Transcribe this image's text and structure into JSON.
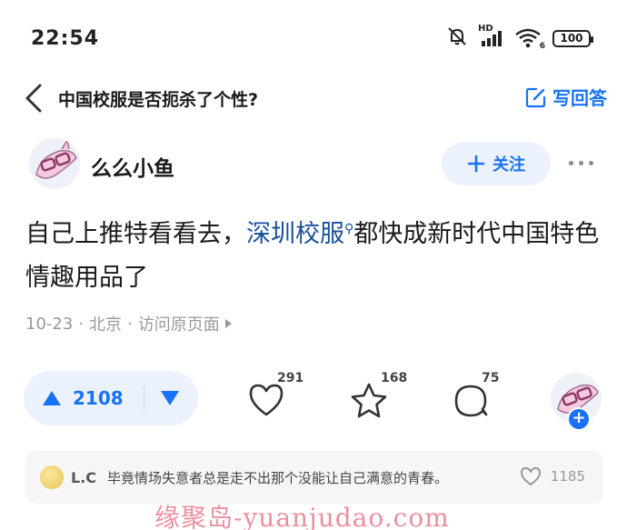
{
  "status_bar": {
    "time": "22:54",
    "network_label": "HD",
    "wifi_label": "6",
    "battery_level": "100",
    "icons": [
      "mute-bell-icon",
      "cellular-signal-icon",
      "wifi-icon",
      "battery-icon"
    ]
  },
  "nav": {
    "title": "中国校服是否扼杀了个性?",
    "write_answer_label": "写回答",
    "icons": [
      "back-arrow-icon",
      "edit-icon"
    ]
  },
  "author": {
    "name": "么么小鱼",
    "follow_label": "关注"
  },
  "answer": {
    "text_before": "自己上推特看看去，",
    "link_text": "深圳校服",
    "text_after": "都快成新时代中国特色情趣用品了"
  },
  "meta": {
    "date": "10-23",
    "location": "北京",
    "visit_label": "访问原页面"
  },
  "actions": {
    "upvotes": "2108",
    "likes": "291",
    "favorites": "168",
    "comments": "75"
  },
  "top_comment": {
    "user": "L.C",
    "text": "毕竟情场失意者总是走不出那个没能让自己满意的青春。",
    "likes": "1185"
  },
  "watermark": "缘聚岛-yuanjudao.com",
  "colors": {
    "accent": "#1772f6",
    "link": "#175199",
    "vote_bg": "#ebf2fd",
    "meta": "#999999",
    "watermark": "#ec8fa0"
  }
}
